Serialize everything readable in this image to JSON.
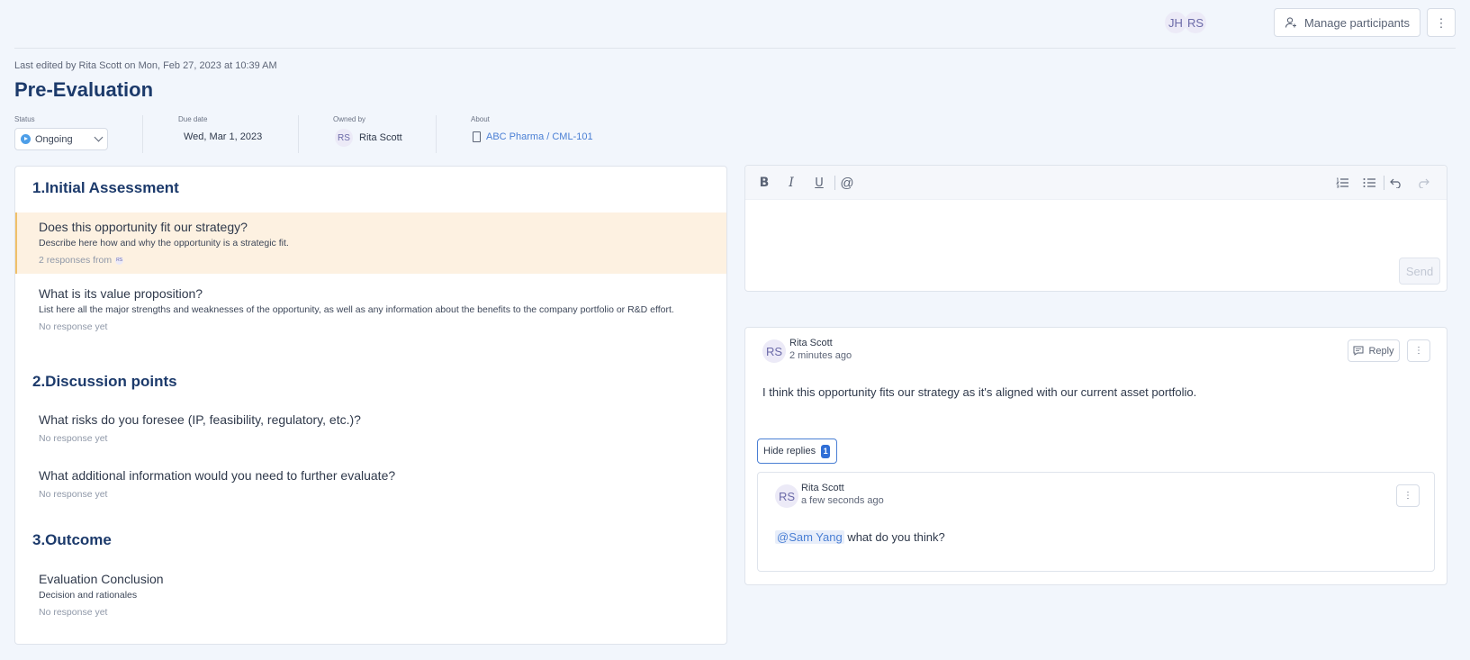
{
  "header": {
    "participants": [
      "JH",
      "RS"
    ],
    "manage_label": "Manage participants",
    "more_glyph": "⋮"
  },
  "meta": {
    "last_edited": "Last edited by Rita Scott on Mon, Feb 27, 2023 at 10:39 AM",
    "title": "Pre-Evaluation"
  },
  "fields": {
    "status_label": "Status",
    "status_value": "Ongoing",
    "due_label": "Due date",
    "due_value": "Wed, Mar 1, 2023",
    "owner_label": "Owned by",
    "owner_initials": "RS",
    "owner_name": "Rita Scott",
    "about_label": "About",
    "about_value": "ABC Pharma / CML-101"
  },
  "sections": [
    {
      "title": "1.Initial Assessment",
      "questions": [
        {
          "title": "Does this opportunity fit our strategy?",
          "desc": "Describe here how and why the opportunity is a strategic fit.",
          "status": "2 responses from",
          "avatar": "RS"
        },
        {
          "title": "What is its value proposition?",
          "desc": "List here all the major strengths and weaknesses of the opportunity, as well as any information about the benefits to the company portfolio or R&D effort.",
          "status": "No response yet"
        }
      ]
    },
    {
      "title": "2.Discussion points",
      "questions": [
        {
          "title": "What risks do you foresee (IP, feasibility, regulatory, etc.)?",
          "status": "No response yet"
        },
        {
          "title": "What additional information would you need to further evaluate?",
          "status": "No response yet"
        }
      ]
    },
    {
      "title": "3.Outcome",
      "questions": [
        {
          "title": "Evaluation Conclusion",
          "desc": "Decision and rationales",
          "status": "No response yet"
        }
      ]
    }
  ],
  "editor": {
    "send_label": "Send",
    "icons": [
      "bold-icon",
      "italic-icon",
      "underline-icon",
      "mention-icon",
      "ordered-list-icon",
      "bullet-list-icon",
      "undo-icon",
      "redo-icon"
    ]
  },
  "comment": {
    "initials": "RS",
    "author": "Rita Scott",
    "time": "2 minutes ago",
    "text": "I think this opportunity fits our strategy as it's aligned with our current asset portfolio.",
    "reply_label": "Reply",
    "hide_replies_label": "Hide replies",
    "reply_count": "1"
  },
  "reply": {
    "initials": "RS",
    "author": "Rita Scott",
    "time": "a few seconds ago",
    "mention": "@Sam Yang",
    "text": " what do you think?"
  },
  "colors": {
    "accent": "#4a7fd4",
    "title": "#1c3a6b",
    "active_bg": "#fdf1e1"
  }
}
